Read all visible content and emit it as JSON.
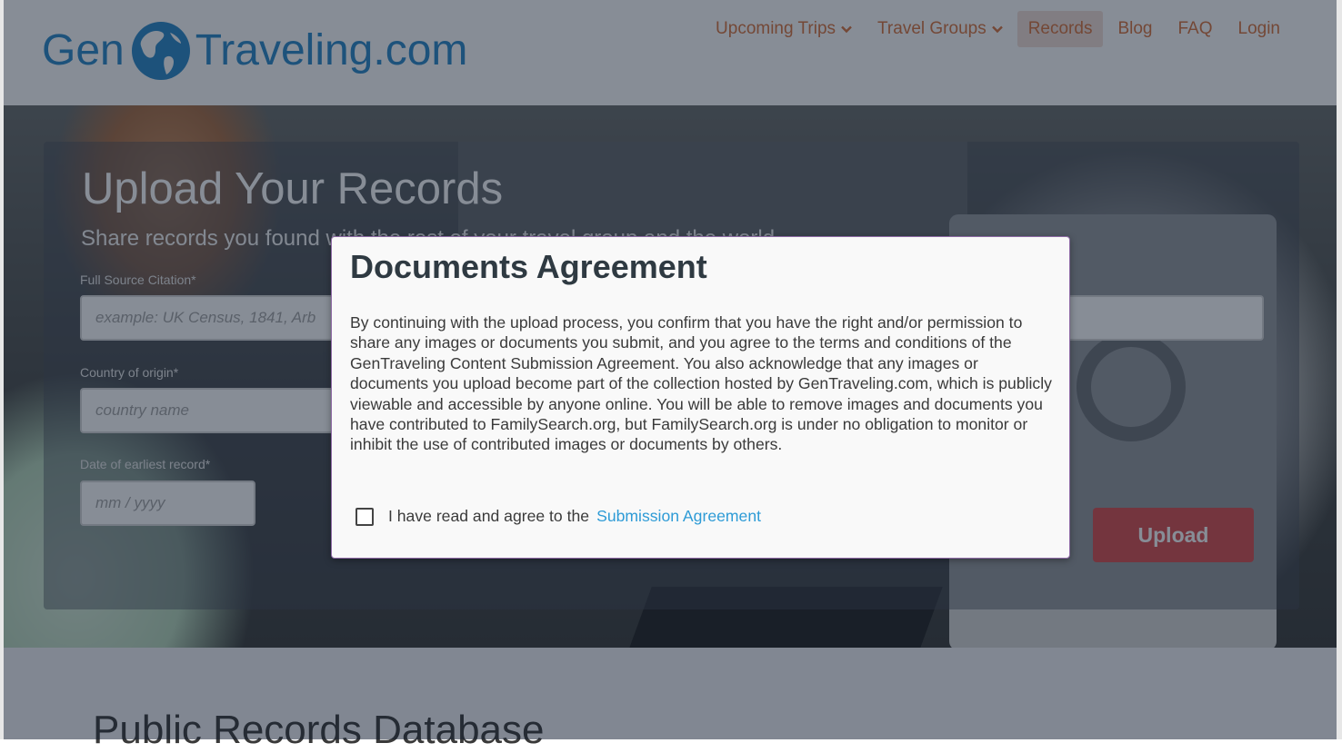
{
  "header": {
    "logo_left": "Gen",
    "logo_right": "Traveling.com",
    "nav": [
      {
        "label": "Upcoming Trips",
        "has_dropdown": true,
        "active": false
      },
      {
        "label": "Travel Groups",
        "has_dropdown": true,
        "active": false
      },
      {
        "label": "Records",
        "has_dropdown": false,
        "active": true
      },
      {
        "label": "Blog",
        "has_dropdown": false,
        "active": false
      },
      {
        "label": "FAQ",
        "has_dropdown": false,
        "active": false
      },
      {
        "label": "Login",
        "has_dropdown": false,
        "active": false
      }
    ]
  },
  "upload_form": {
    "title": "Upload Your Records",
    "subtitle": "Share records you found with the rest of your travel group and the world",
    "citation_label": "Full Source Citation*",
    "citation_placeholder": "example: UK Census, 1841, Arb",
    "country_label": "Country of origin*",
    "country_placeholder": "country name",
    "date_label": "Date of earliest record*",
    "date_placeholder": "mm / yyyy",
    "upload_label": "Upload"
  },
  "section2": {
    "title": "Public Records Database"
  },
  "modal": {
    "title": "Documents Agreement",
    "body": "By continuing with the upload process, you confirm that you have the right and/or permission to share any images or documents you submit, and you agree to the terms and conditions of the GenTraveling Content Submission Agreement. You also acknowledge that any images or documents you upload become part of the collection hosted by GenTraveling.com, which is publicly viewable and accessible by anyone online. You will be able to remove images and documents you have contributed to FamilySearch.org, but FamilySearch.org is under no obligation to monitor or inhibit the use of contributed images or documents by others.",
    "agree_text": "I have read and agree to the",
    "agree_link": "Submission Agreement",
    "checked": false
  },
  "colors": {
    "brand_blue": "#2b88c8",
    "nav_orange": "#d9743f",
    "upload_red": "#d94f4f",
    "link_blue": "#2e9bd6"
  }
}
